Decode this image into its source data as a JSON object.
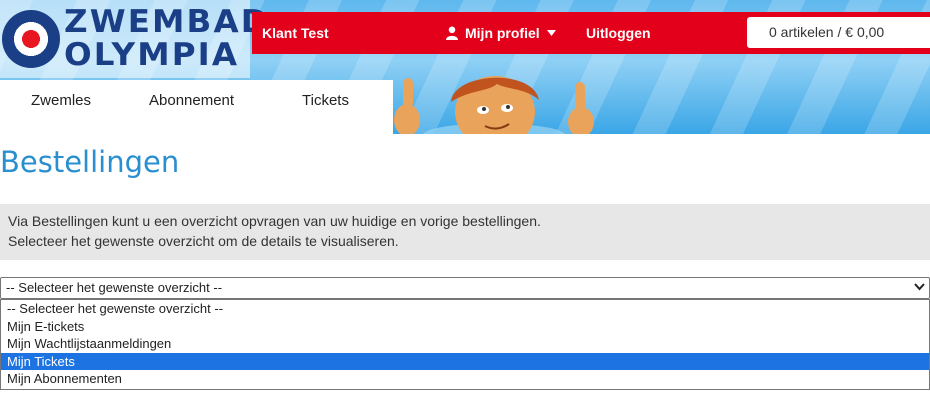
{
  "header": {
    "logo_line1": "ZWEMBAD",
    "logo_line2": "OLYMPIA",
    "customer_name": "Klant Test",
    "profile_label": "Mijn profiel",
    "logout_label": "Uitloggen",
    "cart_label": "0 artikelen / € 0,00"
  },
  "nav": {
    "items": [
      {
        "label": "Zwemles"
      },
      {
        "label": "Abonnement"
      },
      {
        "label": "Tickets"
      }
    ]
  },
  "page": {
    "title": "Bestellingen",
    "info_line1": "Via Bestellingen kunt u een overzicht opvragen van uw huidige en vorige bestellingen.",
    "info_line2": "Selecteer het gewenste overzicht om de details te visualiseren."
  },
  "select": {
    "value": "-- Selecteer het gewenste overzicht --",
    "options": [
      "-- Selecteer het gewenste overzicht --",
      "Mijn E-tickets",
      "Mijn Wachtlijstaanmeldingen",
      "Mijn Tickets",
      "Mijn Abonnementen"
    ],
    "highlighted_option": "Mijn Tickets"
  },
  "colors": {
    "brand_red": "#e2001a",
    "brand_navy": "#1b3f87",
    "title_blue": "#2a8fd0",
    "highlight_blue": "#1e73e3"
  },
  "icons": {
    "profile": "user-icon",
    "profile_caret": "caret-down-icon",
    "select_chevron": "chevron-down-icon"
  }
}
